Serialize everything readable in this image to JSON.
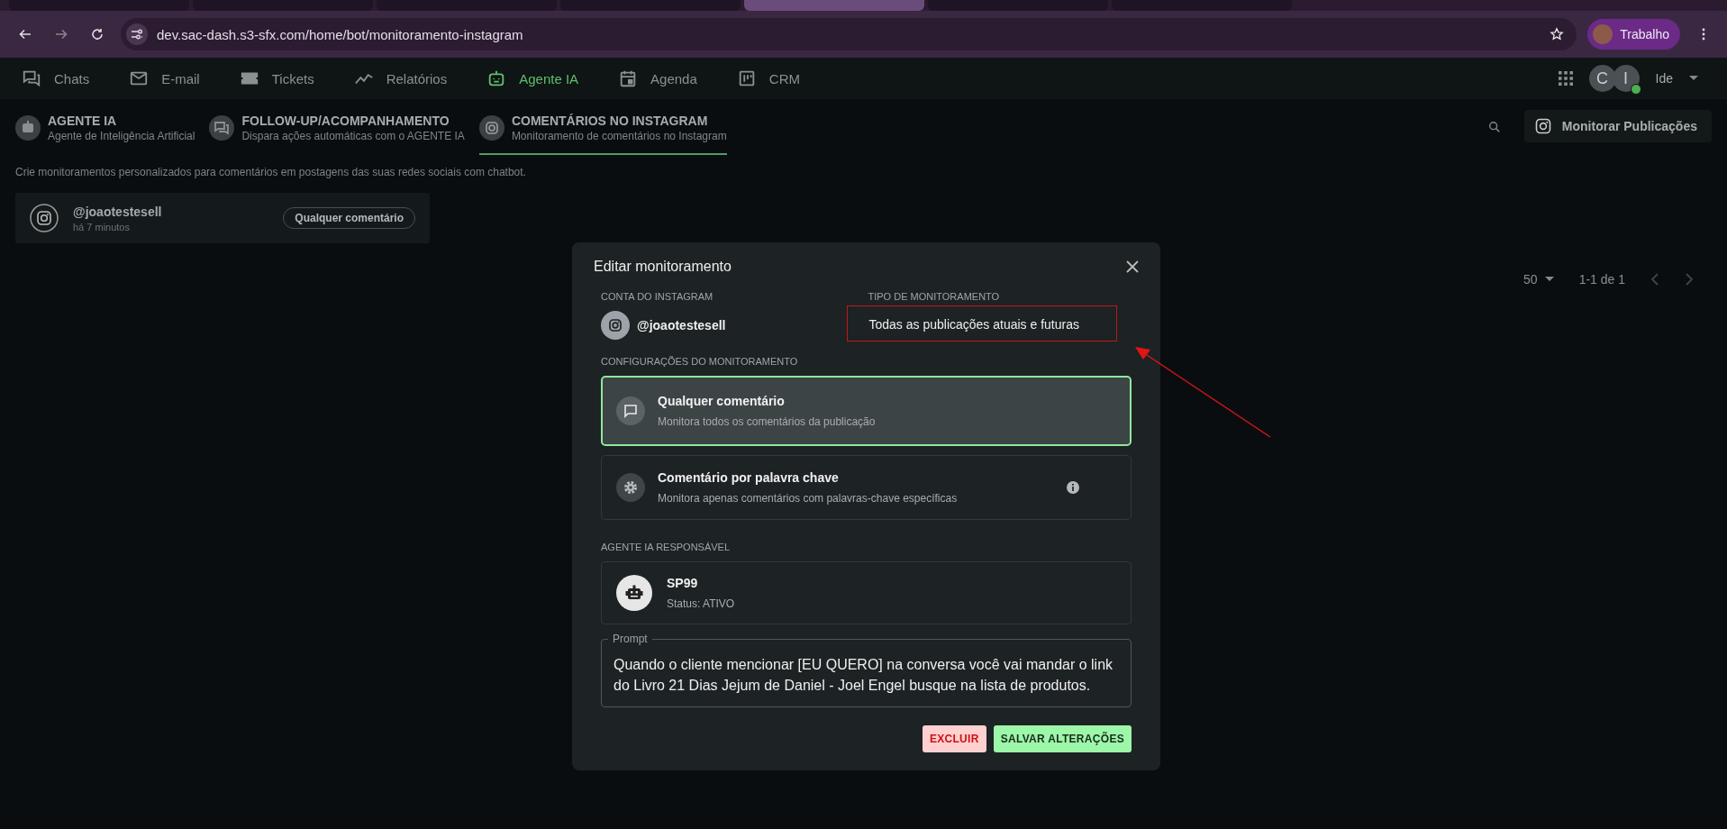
{
  "browser": {
    "url": "dev.sac-dash.s3-sfx.com/home/bot/monitoramento-instagram",
    "profile": "Trabalho",
    "tabs": [
      {
        "selected": false
      },
      {
        "selected": false
      },
      {
        "selected": false
      },
      {
        "selected": false
      },
      {
        "selected": true
      },
      {
        "selected": false
      },
      {
        "selected": false
      }
    ]
  },
  "nav": {
    "items": [
      {
        "label": "Chats",
        "selected": false
      },
      {
        "label": "E-mail",
        "selected": false
      },
      {
        "label": "Tickets",
        "selected": false
      },
      {
        "label": "Relatórios",
        "selected": false
      },
      {
        "label": "Agente IA",
        "selected": true
      },
      {
        "label": "Agenda",
        "selected": false
      },
      {
        "label": "CRM",
        "selected": false
      }
    ],
    "avatars": [
      "C",
      "I"
    ],
    "user": "Ide"
  },
  "subtabs": [
    {
      "title": "AGENTE IA",
      "subtitle": "Agente de Inteligência Artificial",
      "selected": false
    },
    {
      "title": "FOLLOW-UP/ACOMPANHAMENTO",
      "subtitle": "Dispara ações automáticas com o AGENTE IA",
      "selected": false
    },
    {
      "title": "COMENTÁRIOS NO INSTAGRAM",
      "subtitle": "Monitoramento de comentários no Instagram",
      "selected": true
    }
  ],
  "toolbar": {
    "button": "Monitorar Publicações"
  },
  "description": "Crie monitoramentos personalizados para comentários em postagens das suas redes sociais com chatbot.",
  "monitors": [
    {
      "account": "@joaotestesell",
      "time": "há 7 minutos",
      "tag": "Qualquer comentário"
    }
  ],
  "pagination": {
    "per_page": "50",
    "range": "1-1 de 1"
  },
  "dialog": {
    "title": "Editar monitoramento",
    "account_label": "CONTA DO INSTAGRAM",
    "account": "@joaotestesell",
    "type_label": "TIPO DE MONITORAMENTO",
    "type_value": "Todas as publicações atuais e futuras",
    "config_label": "CONFIGURAÇÕES DO MONITORAMENTO",
    "options": [
      {
        "kind": "any",
        "title": "Qualquer comentário",
        "subtitle": "Monitora todos os comentários da publicação",
        "selected": true
      },
      {
        "kind": "keyword",
        "title": "Comentário por palavra chave",
        "subtitle": "Monitora apenas comentários com palavras-chave específicas",
        "selected": false
      }
    ],
    "agent_label": "AGENTE IA RESPONSÁVEL",
    "agent": {
      "name": "SP99",
      "status": "Status: ATIVO"
    },
    "prompt": {
      "label": "Prompt",
      "value": "Quando o cliente mencionar [EU QUERO] na conversa você vai mandar o link do Livro 21 Dias Jejum de Daniel - Joel Engel busque na lista de produtos."
    },
    "buttons": [
      {
        "label": "EXCLUIR",
        "kind": "danger"
      },
      {
        "label": "SALVAR ALTERAÇÕES",
        "kind": "primary"
      }
    ]
  }
}
